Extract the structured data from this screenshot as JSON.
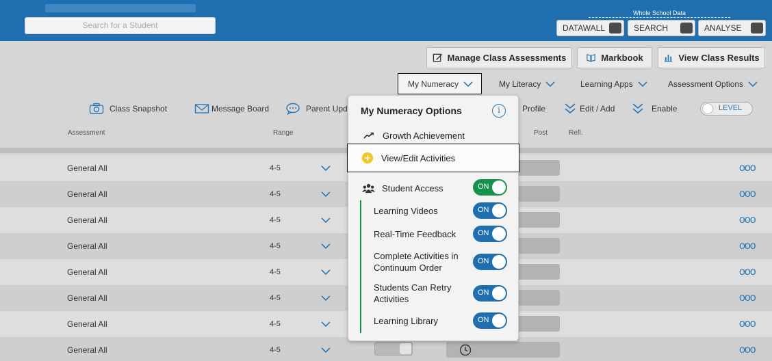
{
  "header": {
    "search_placeholder": "Search for a Student",
    "whole_school_label": "Whole School Data",
    "buttons": [
      "DATAWALL",
      "SEARCH",
      "ANALYSE"
    ]
  },
  "actions": {
    "manage": "Manage Class Assessments",
    "markbook": "Markbook",
    "results": "View Class Results"
  },
  "nav": {
    "numeracy": "My Numeracy",
    "literacy": "My Literacy",
    "apps": "Learning Apps",
    "options": "Assessment Options"
  },
  "toolbar": {
    "snapshot": "Class Snapshot",
    "message": "Message Board",
    "parent": "Parent Upda",
    "profile": "Profile",
    "edit_add": "Edit / Add",
    "enable": "Enable",
    "level": "LEVEL"
  },
  "table": {
    "headers": {
      "assessment": "Assessment",
      "range": "Range",
      "post": "Post",
      "refl": "Refl."
    },
    "rows": [
      {
        "assessment": "General All",
        "range": "4-5"
      },
      {
        "assessment": "General All",
        "range": "4-5"
      },
      {
        "assessment": "General All",
        "range": "4-5"
      },
      {
        "assessment": "General All",
        "range": "4-5"
      },
      {
        "assessment": "General All",
        "range": "4-5"
      },
      {
        "assessment": "General All",
        "range": "4-5"
      },
      {
        "assessment": "General All",
        "range": "4-5"
      },
      {
        "assessment": "General All",
        "range": "4-5"
      }
    ],
    "row_menu": "ooo"
  },
  "panel": {
    "title": "My Numeracy Options",
    "info_icon": "i",
    "growth": "Growth Achievement",
    "view_edit": "View/Edit Activities",
    "student_access": "Student Access",
    "toggle_on": "ON",
    "settings": {
      "videos": "Learning Videos",
      "feedback": "Real-Time Feedback",
      "continuum_1": "Complete Activities in",
      "continuum_2": "Continuum Order",
      "retry_1": "Students Can Retry",
      "retry_2": "Activities",
      "library": "Learning Library"
    }
  },
  "colors": {
    "header_blue": "#1f6fb0",
    "toggle_green": "#16924b",
    "accent_yellow": "#f3c623"
  }
}
